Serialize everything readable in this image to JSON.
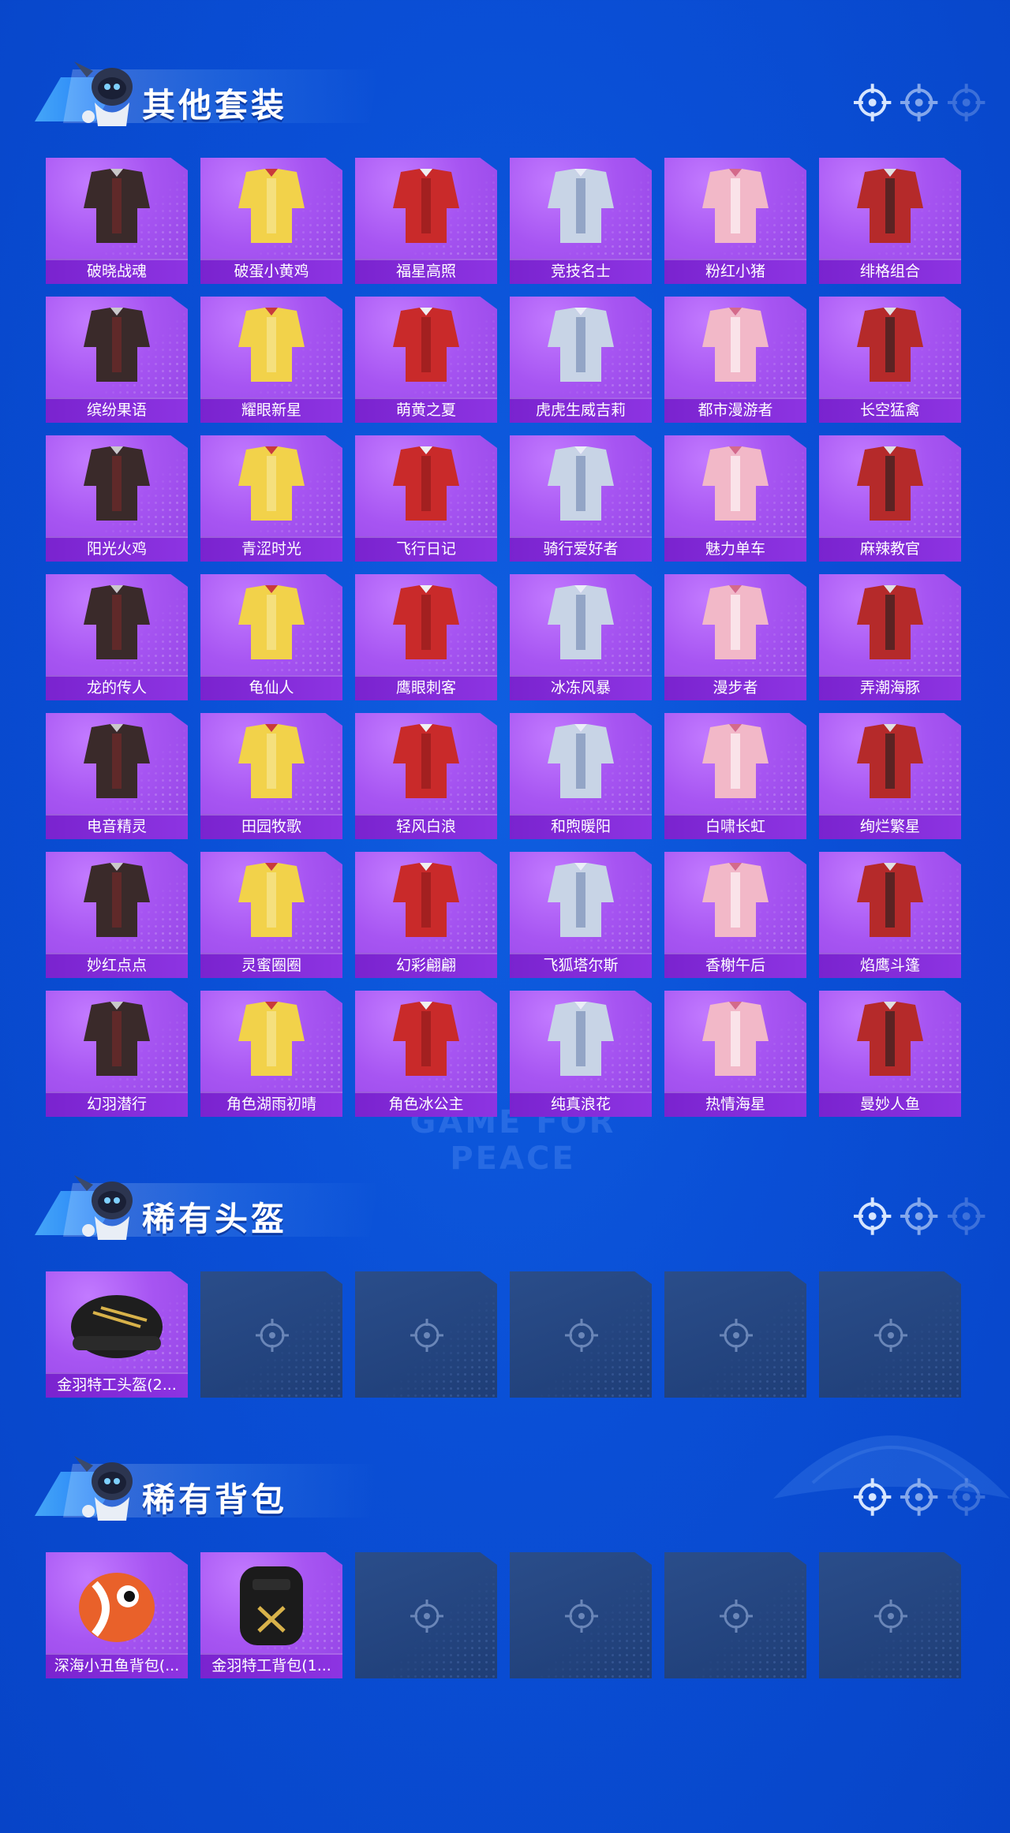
{
  "sections": [
    {
      "title": "其他套装",
      "items": [
        {
          "name": "破晓战魂",
          "art": "hooded-longcoat-outfit"
        },
        {
          "name": "破蛋小黄鸡",
          "art": "chick-costume-outfit"
        },
        {
          "name": "福星高照",
          "art": "red-hooded-outfit"
        },
        {
          "name": "竞技名士",
          "art": "jacket-pants-outfit"
        },
        {
          "name": "粉红小猪",
          "art": "pig-costume-outfit"
        },
        {
          "name": "绯格组合",
          "art": "red-top-skirt-outfit"
        },
        {
          "name": "缤纷果语",
          "art": "fruit-shirt-outfit"
        },
        {
          "name": "耀眼新星",
          "art": "white-shirt-outfit"
        },
        {
          "name": "萌黄之夏",
          "art": "yellow-summer-outfit"
        },
        {
          "name": "虎虎生威吉莉",
          "art": "racing-suit-outfit"
        },
        {
          "name": "都市漫游者",
          "art": "hooded-jacket-outfit"
        },
        {
          "name": "长空猛禽",
          "art": "camo-jacket-outfit"
        },
        {
          "name": "阳光火鸡",
          "art": "blue-shirt-yellow-pants-outfit"
        },
        {
          "name": "青涩时光",
          "art": "black-uniform-outfit"
        },
        {
          "name": "飞行日记",
          "art": "denim-outfit"
        },
        {
          "name": "骑行爱好者",
          "art": "rider-jacket-outfit"
        },
        {
          "name": "魅力单车",
          "art": "yellow-top-skirt-outfit"
        },
        {
          "name": "麻辣教官",
          "art": "officer-outfit"
        },
        {
          "name": "龙的传人",
          "art": "red-dress-outfit"
        },
        {
          "name": "龟仙人",
          "art": "hawaiian-shirt-outfit"
        },
        {
          "name": "鹰眼刺客",
          "art": "black-assassin-outfit"
        },
        {
          "name": "冰冻风暴",
          "art": "dark-hooded-outfit"
        },
        {
          "name": "漫步者",
          "art": "black-jacket-outfit"
        },
        {
          "name": "弄潮海豚",
          "art": "dolphin-outfit"
        },
        {
          "name": "电音精灵",
          "art": "electro-outfit"
        },
        {
          "name": "田园牧歌",
          "art": "pastoral-outfit"
        },
        {
          "name": "轻风白浪",
          "art": "light-dress-outfit"
        },
        {
          "name": "和煦暖阳",
          "art": "pink-white-outfit"
        },
        {
          "name": "白啸长虹",
          "art": "white-racer-outfit"
        },
        {
          "name": "绚烂繁星",
          "art": "starry-outfit"
        },
        {
          "name": "妙红点点",
          "art": "polka-red-outfit"
        },
        {
          "name": "灵蜜圈圈",
          "art": "honey-outfit"
        },
        {
          "name": "幻彩翩翩",
          "art": "pastel-dress-outfit"
        },
        {
          "name": "飞狐塔尔斯",
          "art": "fox-outfit"
        },
        {
          "name": "香榭午后",
          "art": "cream-outfit"
        },
        {
          "name": "焰鹰斗篷",
          "art": "red-black-cloak-outfit"
        },
        {
          "name": "幻羽潜行",
          "art": "dark-feather-outfit"
        },
        {
          "name": "角色湖雨初晴",
          "art": "character-dress-outfit"
        },
        {
          "name": "角色冰公主",
          "art": "ice-princess-outfit"
        },
        {
          "name": "纯真浪花",
          "art": "wave-outfit"
        },
        {
          "name": "热情海星",
          "art": "starfish-outfit"
        },
        {
          "name": "曼妙人鱼",
          "art": "mermaid-outfit"
        }
      ]
    },
    {
      "title": "稀有头盔",
      "items": [
        {
          "name": "金羽特工头盔(2...",
          "art": "helmet"
        }
      ],
      "empty_slots": 5
    },
    {
      "title": "稀有背包",
      "items": [
        {
          "name": "深海小丑鱼背包(...",
          "art": "clownfish-backpack"
        },
        {
          "name": "金羽特工背包(1...",
          "art": "black-backpack"
        }
      ],
      "empty_slots": 4
    }
  ],
  "icons": {
    "section_marker": "crosshair-icon",
    "empty_slot": "crosshair-icon",
    "mascot": "mascot-icon"
  },
  "colors": {
    "background": "#0a4fd6",
    "card_filled": "#a755f2",
    "card_label": "#7a23cf",
    "card_empty": "#244680"
  },
  "watermark": "GAME FOR PEACE"
}
